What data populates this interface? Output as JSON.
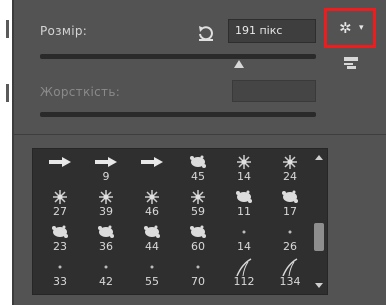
{
  "brush_panel": {
    "size_label": "Розмір:",
    "size_value": "191 пікс",
    "size_level": 0.72,
    "hardness_label": "Жорсткість:",
    "hardness_value": ""
  },
  "icons": {
    "reset": "reset-icon",
    "gear": "gear-icon",
    "new_preset": "new-preset-icon"
  },
  "accent_color": "#ee1c1c",
  "brushes": [
    {
      "num": "",
      "kind": "arrow"
    },
    {
      "num": "9",
      "kind": "arrow"
    },
    {
      "num": "",
      "kind": "arrow"
    },
    {
      "num": "45",
      "kind": "splat"
    },
    {
      "num": "14",
      "kind": "burst"
    },
    {
      "num": "24",
      "kind": "burst"
    },
    {
      "num": "27",
      "kind": "burst"
    },
    {
      "num": "39",
      "kind": "burst"
    },
    {
      "num": "46",
      "kind": "burst"
    },
    {
      "num": "59",
      "kind": "burst"
    },
    {
      "num": "11",
      "kind": "splat"
    },
    {
      "num": "17",
      "kind": "splat"
    },
    {
      "num": "23",
      "kind": "splat"
    },
    {
      "num": "36",
      "kind": "splat"
    },
    {
      "num": "44",
      "kind": "splat"
    },
    {
      "num": "60",
      "kind": "splat"
    },
    {
      "num": "14",
      "kind": "dot"
    },
    {
      "num": "26",
      "kind": "dot"
    },
    {
      "num": "33",
      "kind": "dot"
    },
    {
      "num": "42",
      "kind": "dot"
    },
    {
      "num": "55",
      "kind": "dot"
    },
    {
      "num": "70",
      "kind": "dot"
    },
    {
      "num": "112",
      "kind": "grass"
    },
    {
      "num": "134",
      "kind": "grass"
    }
  ]
}
